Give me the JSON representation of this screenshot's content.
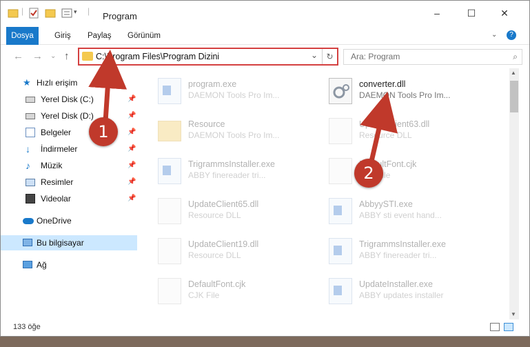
{
  "window": {
    "title": "Program"
  },
  "ribbon": {
    "tabs": [
      "Dosya",
      "Giriş",
      "Paylaş",
      "Görünüm"
    ]
  },
  "address": {
    "path": "C:\\Program Files\\Program Dizini"
  },
  "search": {
    "placeholder": "Ara: Program"
  },
  "sidebar": {
    "quick_access": "Hızlı erişim",
    "items": [
      "Yerel Disk (C:)",
      "Yerel Disk (D:)",
      "Belgeler",
      "İndirmeler",
      "Müzik",
      "Resimler",
      "Videolar"
    ],
    "onedrive": "OneDrive",
    "this_pc": "Bu bilgisayar",
    "network": "Ağ"
  },
  "files": [
    {
      "name": "program.exe",
      "desc": "DAEMON Tools Pro Im...",
      "type": "exe"
    },
    {
      "name": "converter.dll",
      "desc": "DAEMON Tools Pro Im...",
      "type": "dll"
    },
    {
      "name": "Resource",
      "desc": "DAEMON Tools Pro Im...",
      "type": "folder"
    },
    {
      "name": "UpdateClient63.dll",
      "desc": "Resource DLL",
      "type": "dll"
    },
    {
      "name": "TrigrammsInstaller.exe",
      "desc": "ABBY finereader tri...",
      "type": "exe"
    },
    {
      "name": "DefaultFont.cjk",
      "desc": "CJK File",
      "type": "file"
    },
    {
      "name": "UpdateClient65.dll",
      "desc": "Resource DLL",
      "type": "dll"
    },
    {
      "name": "AbbyySTI.exe",
      "desc": "ABBY sti event hand...",
      "type": "exe"
    },
    {
      "name": "UpdateClient19.dll",
      "desc": "Resource DLL",
      "type": "dll"
    },
    {
      "name": "TrigrammsInstaller.exe",
      "desc": "ABBY finereader tri...",
      "type": "exe"
    },
    {
      "name": "DefaultFont.cjk",
      "desc": "CJK File",
      "type": "file"
    },
    {
      "name": "UpdateInstaller.exe",
      "desc": "ABBY updates installer",
      "type": "exe"
    }
  ],
  "status": {
    "count": "133 öğe"
  },
  "annotations": {
    "badge1": "1",
    "badge2": "2"
  },
  "colors": {
    "accent": "#1979ca",
    "highlight": "#d44040",
    "badge": "#c0392b"
  }
}
